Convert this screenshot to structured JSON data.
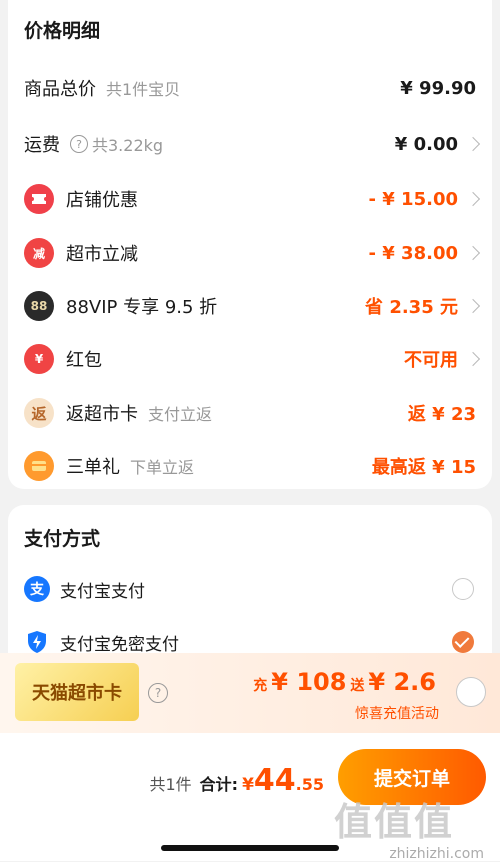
{
  "price_detail": {
    "title": "价格明细",
    "items": [
      {
        "label": "商品总价",
        "sub": "共1件宝贝",
        "value": "¥ 99.90"
      },
      {
        "label": "运费",
        "sub": "共3.22kg",
        "value": "¥ 0.00"
      },
      {
        "label": "店铺优惠",
        "value": "- ¥ 15.00",
        "icon": "ticket-icon",
        "icon_color": "#f0404a"
      },
      {
        "label": "超市立减",
        "value": "- ¥ 38.00",
        "icon": "cut-icon",
        "icon_text": "减",
        "icon_color": "#f04444"
      },
      {
        "label": "88VIP 专享 9.5 折",
        "value": "省 2.35 元",
        "icon": "vip-88-icon",
        "icon_text": "88",
        "icon_color": "#2a2a2a"
      },
      {
        "label": "红包",
        "value": "不可用",
        "icon": "red-packet-icon",
        "icon_text": "¥",
        "icon_color": "#f04444"
      },
      {
        "label": "返超市卡",
        "sub": "支付立返",
        "value": "返 ¥ 23",
        "icon": "cashback-icon",
        "icon_text": "返",
        "icon_color": "#f7e2c8"
      },
      {
        "label": "三单礼",
        "sub": "下单立返",
        "value": "最高返 ¥ 15",
        "icon": "card-gift-icon",
        "icon_color": "#ff9a2e"
      }
    ]
  },
  "payment": {
    "title": "支付方式",
    "methods": [
      {
        "label": "支付宝支付",
        "icon": "alipay-icon",
        "icon_text": "支",
        "checked": false
      },
      {
        "label": "支付宝免密支付",
        "icon": "lightning-shield-icon",
        "checked": true
      }
    ]
  },
  "promo": {
    "card_label": "天猫超市卡",
    "recharge_prefix": "充",
    "recharge_amount": "¥ 108",
    "bonus_prefix": "送",
    "bonus_amount": "¥ 2.6",
    "caption": "惊喜充值活动"
  },
  "footer": {
    "count_text": "共1件",
    "total_label": "合计:",
    "currency": "¥",
    "total_int": "44",
    "total_dec": ".55",
    "submit_label": "提交订单",
    "watermark_glyphs": "值值值",
    "watermark_text": "zhizhizhi.com"
  },
  "colors": {
    "accent": "#ff5000",
    "check": "#f07a3c"
  }
}
